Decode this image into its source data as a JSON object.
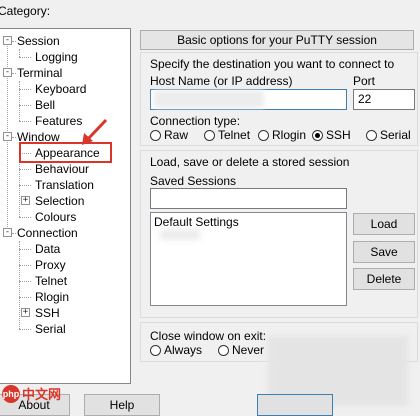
{
  "category_label": "Category:",
  "tree": [
    {
      "label": "Session",
      "level": 0,
      "expander": "-"
    },
    {
      "label": "Logging",
      "level": 1
    },
    {
      "label": "Terminal",
      "level": 0,
      "expander": "-"
    },
    {
      "label": "Keyboard",
      "level": 1
    },
    {
      "label": "Bell",
      "level": 1
    },
    {
      "label": "Features",
      "level": 1
    },
    {
      "label": "Window",
      "level": 0,
      "expander": "-"
    },
    {
      "label": "Appearance",
      "level": 1,
      "highlighted": true
    },
    {
      "label": "Behaviour",
      "level": 1
    },
    {
      "label": "Translation",
      "level": 1
    },
    {
      "label": "Selection",
      "level": 1,
      "expander": "+"
    },
    {
      "label": "Colours",
      "level": 1
    },
    {
      "label": "Connection",
      "level": 0,
      "expander": "-"
    },
    {
      "label": "Data",
      "level": 1
    },
    {
      "label": "Proxy",
      "level": 1
    },
    {
      "label": "Telnet",
      "level": 1
    },
    {
      "label": "Rlogin",
      "level": 1
    },
    {
      "label": "SSH",
      "level": 1,
      "expander": "+"
    },
    {
      "label": "Serial",
      "level": 1
    }
  ],
  "panel": {
    "header": "Basic options for your PuTTY session",
    "destination_label": "Specify the destination you want to connect to",
    "host_label": "Host Name (or IP address)",
    "host_value": "",
    "port_label": "Port",
    "port_value": "22",
    "conn_type_label": "Connection type:",
    "conn_types": [
      {
        "label": "Raw",
        "selected": false
      },
      {
        "label": "Telnet",
        "selected": false
      },
      {
        "label": "Rlogin",
        "selected": false
      },
      {
        "label": "SSH",
        "selected": true
      },
      {
        "label": "Serial",
        "selected": false
      }
    ],
    "sessions_group_label": "Load, save or delete a stored session",
    "saved_sessions_label": "Saved Sessions",
    "saved_sessions_value": "",
    "sessions_list": [
      "Default Settings"
    ],
    "load_label": "Load",
    "save_label": "Save",
    "delete_label": "Delete",
    "close_label": "Close window on exit:",
    "close_options": [
      {
        "label": "Always",
        "selected": false
      },
      {
        "label": "Never",
        "selected": false
      }
    ]
  },
  "bottom": {
    "about_label": "About",
    "help_label": "Help"
  },
  "watermark": {
    "logo": "php",
    "text": "中文网"
  },
  "colors": {
    "highlight": "#d9362b",
    "accent": "#3c7fb1"
  }
}
